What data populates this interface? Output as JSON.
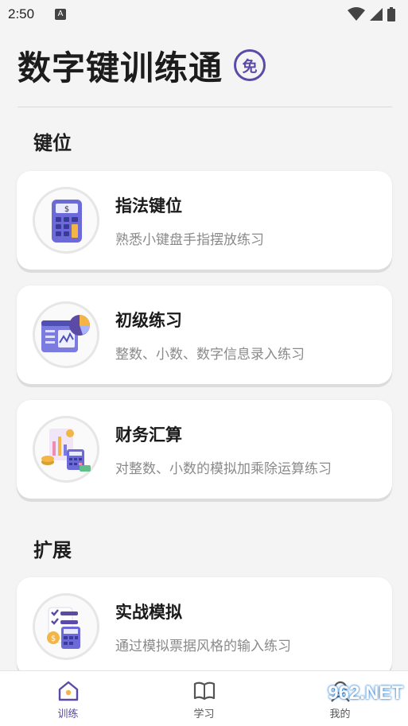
{
  "status_bar": {
    "time": "2:50",
    "app_icon": "A"
  },
  "header": {
    "title": "数字键训练通",
    "badge": "免"
  },
  "sections": [
    {
      "title": "键位"
    },
    {
      "title": "扩展"
    }
  ],
  "cards": [
    {
      "title": "指法键位",
      "desc": "熟悉小键盘手指摆放练习",
      "icon": "calculator-icon"
    },
    {
      "title": "初级练习",
      "desc": "整数、小数、数字信息录入练习",
      "icon": "dashboard-chart-icon"
    },
    {
      "title": "财务汇算",
      "desc": "对整数、小数的模拟加乘除运算练习",
      "icon": "finance-icon"
    },
    {
      "title": "实战模拟",
      "desc": "通过模拟票据风格的输入练习",
      "icon": "checklist-calculator-icon"
    }
  ],
  "nav": [
    {
      "label": "训练",
      "icon": "home-icon",
      "active": true
    },
    {
      "label": "学习",
      "icon": "book-icon",
      "active": false
    },
    {
      "label": "我的",
      "icon": "user-icon",
      "active": false
    }
  ],
  "watermark": "962.NET",
  "colors": {
    "accent": "#5b4aa6",
    "background": "#f4f4f5"
  }
}
